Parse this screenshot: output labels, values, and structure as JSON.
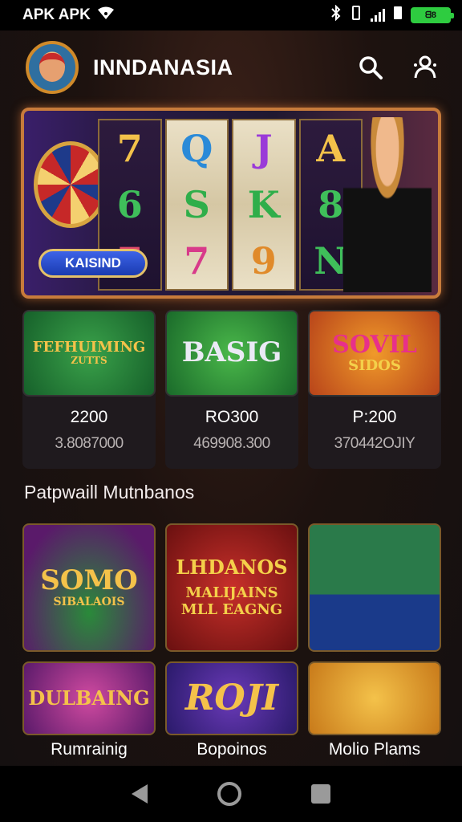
{
  "status_bar": {
    "carrier": "APK APK",
    "battery_label": "ᗺ8"
  },
  "header": {
    "title": "INNDANASIA"
  },
  "hero": {
    "reels": [
      [
        "7",
        "6",
        "7"
      ],
      [
        "Q",
        "S",
        "7"
      ],
      [
        "J",
        "K",
        "9"
      ],
      [
        "A",
        "8",
        "N"
      ]
    ],
    "button_label": "KAISIND"
  },
  "featured": [
    {
      "art_title": "FEFHUIMING",
      "art_sub": "ZUTTS",
      "price": "2200",
      "subtext": "3.8087000"
    },
    {
      "art_title": "BASIG",
      "art_sub": "",
      "price": "RO300",
      "subtext": "469908.300"
    },
    {
      "art_title": "SOVIL",
      "art_sub": "SIDOS",
      "price": "P:200",
      "subtext": "370442OJIY"
    }
  ],
  "section_title": "Patpwaill Mutnbanos",
  "grid_row1": [
    {
      "title": "SOMO",
      "sub": "SIBALAOIS"
    },
    {
      "title": "LHDANOS",
      "sub": "MALIJAINS MLL EAGNG"
    },
    {
      "title": "",
      "sub": ""
    }
  ],
  "grid_row2": [
    {
      "title": "DULBAING",
      "sub": ""
    },
    {
      "title": "ROJI",
      "sub": ""
    },
    {
      "title": "",
      "sub": ""
    }
  ],
  "bottom_labels": [
    "Rumrainig",
    "Bopoinos",
    "Molio Plams"
  ],
  "colors": {
    "accent_gold": "#c77b3b",
    "hero_button": "#2f55d8",
    "status_battery": "#2ecc40"
  }
}
